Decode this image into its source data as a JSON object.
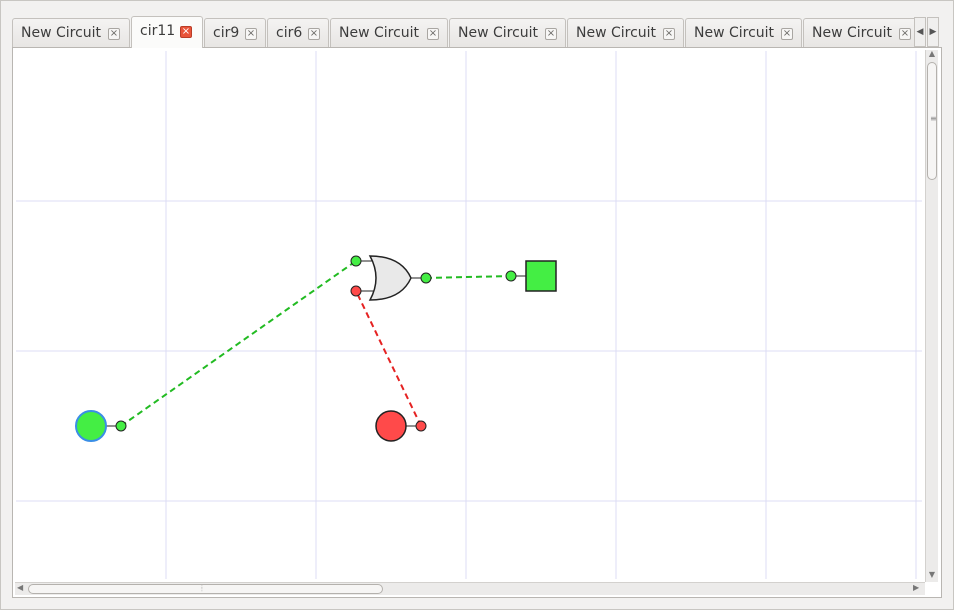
{
  "tabs": [
    {
      "label": "New Circuit",
      "active": false
    },
    {
      "label": "cir11",
      "active": true
    },
    {
      "label": "cir9",
      "active": false
    },
    {
      "label": "cir6",
      "active": false
    },
    {
      "label": "New Circuit",
      "active": false
    },
    {
      "label": "New Circuit",
      "active": false
    },
    {
      "label": "New Circuit",
      "active": false
    },
    {
      "label": "New Circuit",
      "active": false
    },
    {
      "label": "New Circuit",
      "active": false
    }
  ],
  "icons": {
    "tab_close": "close-icon",
    "tab_scroll_left": "arrow-left-icon",
    "tab_scroll_right": "arrow-right-icon"
  },
  "colors": {
    "signal_high": "#44ee44",
    "signal_low": "#ff4a4a",
    "gate_fill": "#e9e9e9",
    "grid": "#dcdcf4",
    "input_border_selected": "#3a8ee6"
  },
  "circuit": {
    "components": [
      {
        "id": "input-high",
        "type": "input",
        "state": "high",
        "selected": true
      },
      {
        "id": "input-low",
        "type": "input",
        "state": "low",
        "selected": false
      },
      {
        "id": "or-gate",
        "type": "OR",
        "state": "high"
      },
      {
        "id": "output",
        "type": "output",
        "state": "high"
      }
    ],
    "wires": [
      {
        "from": "input-high",
        "to": "or-gate.in1",
        "state": "high"
      },
      {
        "from": "input-low",
        "to": "or-gate.in2",
        "state": "low"
      },
      {
        "from": "or-gate.out",
        "to": "output",
        "state": "high"
      }
    ]
  }
}
